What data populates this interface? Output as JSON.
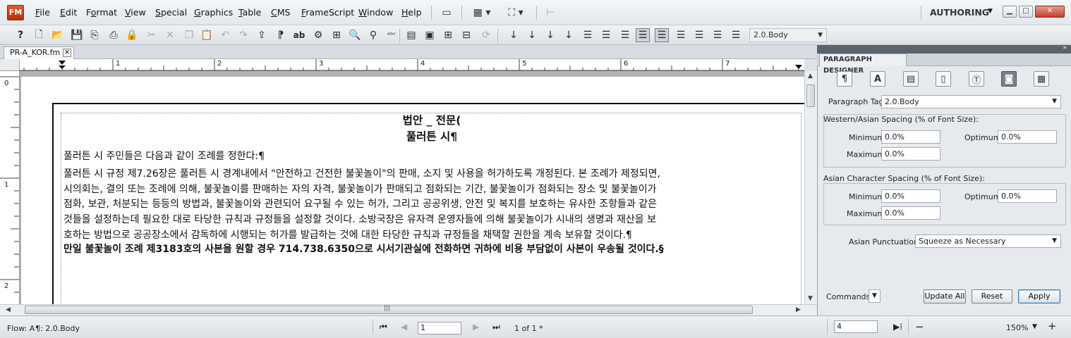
{
  "app": {
    "logo": "FM",
    "mode": "AUTHORING"
  },
  "menu": [
    "File",
    "Edit",
    "Format",
    "View",
    "Special",
    "Graphics",
    "Table",
    "CMS",
    "FrameScript",
    "Window",
    "Help"
  ],
  "menu_underline": [
    "F",
    "E",
    "o",
    "V",
    "S",
    "G",
    "T",
    "C",
    "F",
    "W",
    "H"
  ],
  "toolbar": {
    "paragraph_style": "2.0.Body"
  },
  "doc_tab": {
    "title": "PR-A_KOR.fm"
  },
  "ruler": {
    "h_marks": [
      "1",
      "2",
      "3",
      "4",
      "5",
      "6",
      "7"
    ],
    "v_marks": [
      "0",
      "1",
      "2"
    ]
  },
  "document": {
    "heading1": "법안 _ 전문(",
    "heading2": "풀러튼 시¶",
    "para1": "풀러튼 시 주민들은 다음과 같이 조례를 정한다:¶",
    "para2": "풀러튼 시 규정 제7.26장은 풀러튼 시 경계내에서 \"안전하고 건전한 불꽃놀이\"의 판매, 소지 및 사용을 허가하도록 개정된다. 본 조례가 제정되면,\n시의회는, 결의 또는 조례에 의해, 불꽃놀이를 판매하는 자의 자격, 불꽃놀이가 판매되고 점화되는 기간, 불꽃놀이가 점화되는 장소 및 불꽃놀이가\n점화, 보관, 처분되는 등등의 방법과, 불꽃놀이와 관련되어 요구될 수 있는 허가, 그리고 공공위생, 안전 및 복지를 보호하는 유사한 조항들과 같은\n것들을 설정하는데 필요한 대로 타당한 규칙과 규정들을 설정할 것이다. 소방국장은 유자격 운영자들에 의해 불꽃놀이가 시내의 생명과 재산을 보\n호하는 방법으로 공공장소에서 감독하에 시행되는 허가를 발급하는 것에 대한 타당한 규칙과 규정들을 채택할 권한을 계속 보유할 것이다.¶",
    "para3": "만일 불꽃놀이 조례 제3183호의 사본을 원할 경우 714.738.6350으로 시서기관실에 전화하면 귀하에 비용 부담없이 사본이 우송될 것이다.§"
  },
  "panel": {
    "title": "PARAGRAPH DESIGNER",
    "paragraph_tag_label": "Paragraph Tag:",
    "paragraph_tag_value": "2.0.Body",
    "western_label": "Western/Asian Spacing (% of Font Size):",
    "asian_label": "Asian Character Spacing (% of Font Size):",
    "minimum_label": "Minimum:",
    "maximum_label": "Maximum:",
    "optimum_label": "Optimum:",
    "western": {
      "minimum": "0.0%",
      "maximum": "0.0%",
      "optimum": "0.0%"
    },
    "asian": {
      "minimum": "0.0%",
      "maximum": "0.0%",
      "optimum": "0.0%"
    },
    "punct_label": "Asian Punctuation:",
    "punct_value": "Squeeze as Necessary",
    "commands_label": "Commands:",
    "update_all": "Update All",
    "reset": "Reset",
    "apply": "Apply"
  },
  "status": {
    "flow": "Flow: A",
    "tag": "¶: 2.0.Body",
    "page_field": "1",
    "page_count": "1 of 1 *",
    "zoom_field": "4",
    "zoom": "150%"
  }
}
